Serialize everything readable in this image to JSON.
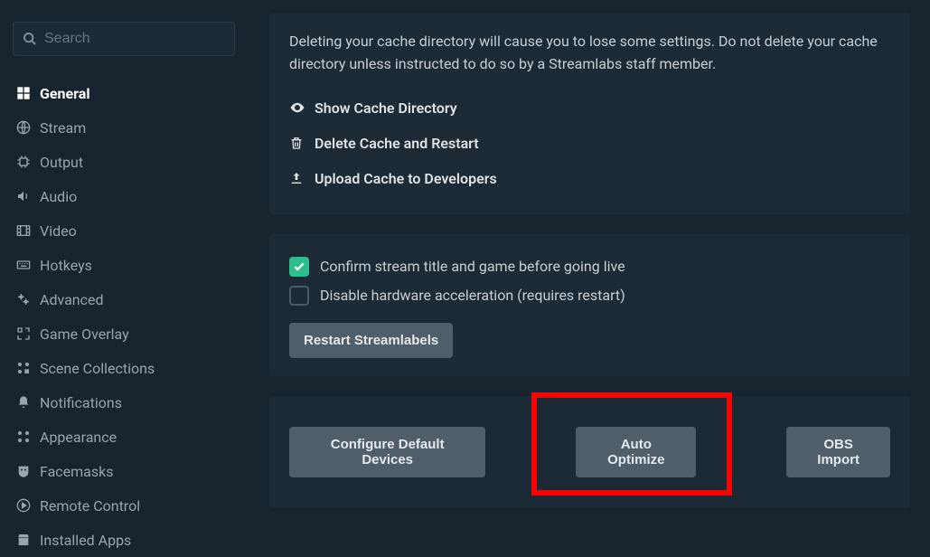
{
  "search": {
    "placeholder": "Search"
  },
  "sidebar": {
    "items": [
      {
        "label": "General",
        "icon": "grid-icon",
        "active": true
      },
      {
        "label": "Stream",
        "icon": "globe-icon",
        "active": false
      },
      {
        "label": "Output",
        "icon": "chip-icon",
        "active": false
      },
      {
        "label": "Audio",
        "icon": "volume-icon",
        "active": false
      },
      {
        "label": "Video",
        "icon": "film-icon",
        "active": false
      },
      {
        "label": "Hotkeys",
        "icon": "keyboard-icon",
        "active": false
      },
      {
        "label": "Advanced",
        "icon": "gears-icon",
        "active": false
      },
      {
        "label": "Game Overlay",
        "icon": "overlay-icon",
        "active": false
      },
      {
        "label": "Scene Collections",
        "icon": "scenes-icon",
        "active": false
      },
      {
        "label": "Notifications",
        "icon": "bell-icon",
        "active": false
      },
      {
        "label": "Appearance",
        "icon": "appearance-icon",
        "active": false
      },
      {
        "label": "Facemasks",
        "icon": "mask-icon",
        "active": false
      },
      {
        "label": "Remote Control",
        "icon": "play-circle-icon",
        "active": false
      },
      {
        "label": "Installed Apps",
        "icon": "store-icon",
        "active": false
      }
    ]
  },
  "cache_panel": {
    "text": "Deleting your cache directory will cause you to lose some settings. Do not delete your cache directory unless instructed to do so by a Streamlabs staff member.",
    "actions": [
      {
        "label": "Show Cache Directory",
        "icon": "eye-icon"
      },
      {
        "label": "Delete Cache and Restart",
        "icon": "trash-icon"
      },
      {
        "label": "Upload Cache to Developers",
        "icon": "upload-icon"
      }
    ]
  },
  "options_panel": {
    "checkboxes": [
      {
        "label": "Confirm stream title and game before going live",
        "checked": true
      },
      {
        "label": "Disable hardware acceleration (requires restart)",
        "checked": false
      }
    ],
    "button": "Restart Streamlabels"
  },
  "buttons_panel": {
    "b1": "Configure Default Devices",
    "b2": "Auto Optimize",
    "b3": "OBS Import"
  },
  "highlight": "auto-optimize-button"
}
